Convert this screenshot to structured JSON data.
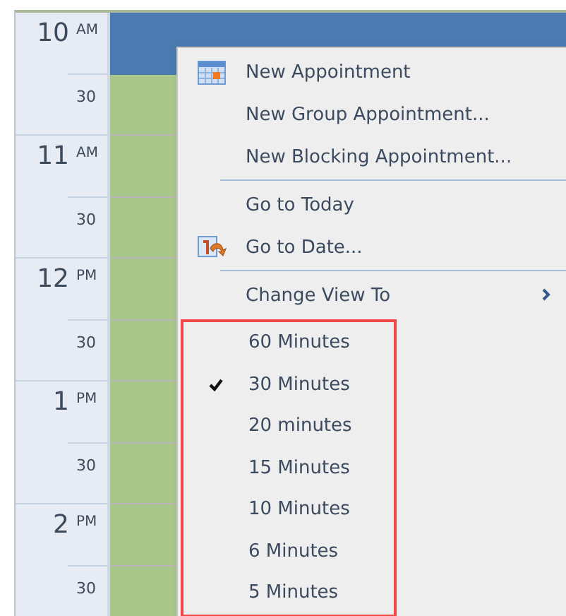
{
  "time_ruler": [
    {
      "hour": "10",
      "period": "AM",
      "half": "30"
    },
    {
      "hour": "11",
      "period": "AM",
      "half": "30"
    },
    {
      "hour": "12",
      "period": "PM",
      "half": "30"
    },
    {
      "hour": "1",
      "period": "PM",
      "half": "30"
    },
    {
      "hour": "2",
      "period": "PM",
      "half": "30"
    }
  ],
  "time_slots": [
    {
      "selected": true
    },
    {
      "selected": false
    },
    {
      "selected": false
    },
    {
      "selected": false
    },
    {
      "selected": false
    },
    {
      "selected": false
    },
    {
      "selected": false
    },
    {
      "selected": false
    },
    {
      "selected": false
    },
    {
      "selected": false
    }
  ],
  "context_menu": {
    "items": [
      {
        "kind": "calendar",
        "label": "New Appointment",
        "separator_before": false
      },
      {
        "kind": "plain",
        "label": "New Group Appointment...",
        "separator_before": false
      },
      {
        "kind": "plain",
        "label": "New Blocking Appointment...",
        "separator_before": false
      },
      {
        "kind": "plain",
        "label": "Go to Today",
        "separator_before": true
      },
      {
        "kind": "goto",
        "label": "Go to Date...",
        "separator_before": false
      },
      {
        "kind": "submenu",
        "label": "Change View To",
        "separator_before": true
      }
    ],
    "view_options": {
      "highlighted": true,
      "items": [
        {
          "label": "60 Minutes",
          "checked": false
        },
        {
          "label": "30 Minutes",
          "checked": true
        },
        {
          "label": "20 minutes",
          "checked": false
        },
        {
          "label": "15 Minutes",
          "checked": false
        },
        {
          "label": "10 Minutes",
          "checked": false
        },
        {
          "label": "6 Minutes",
          "checked": false
        },
        {
          "label": "5 Minutes",
          "checked": false
        }
      ]
    }
  }
}
